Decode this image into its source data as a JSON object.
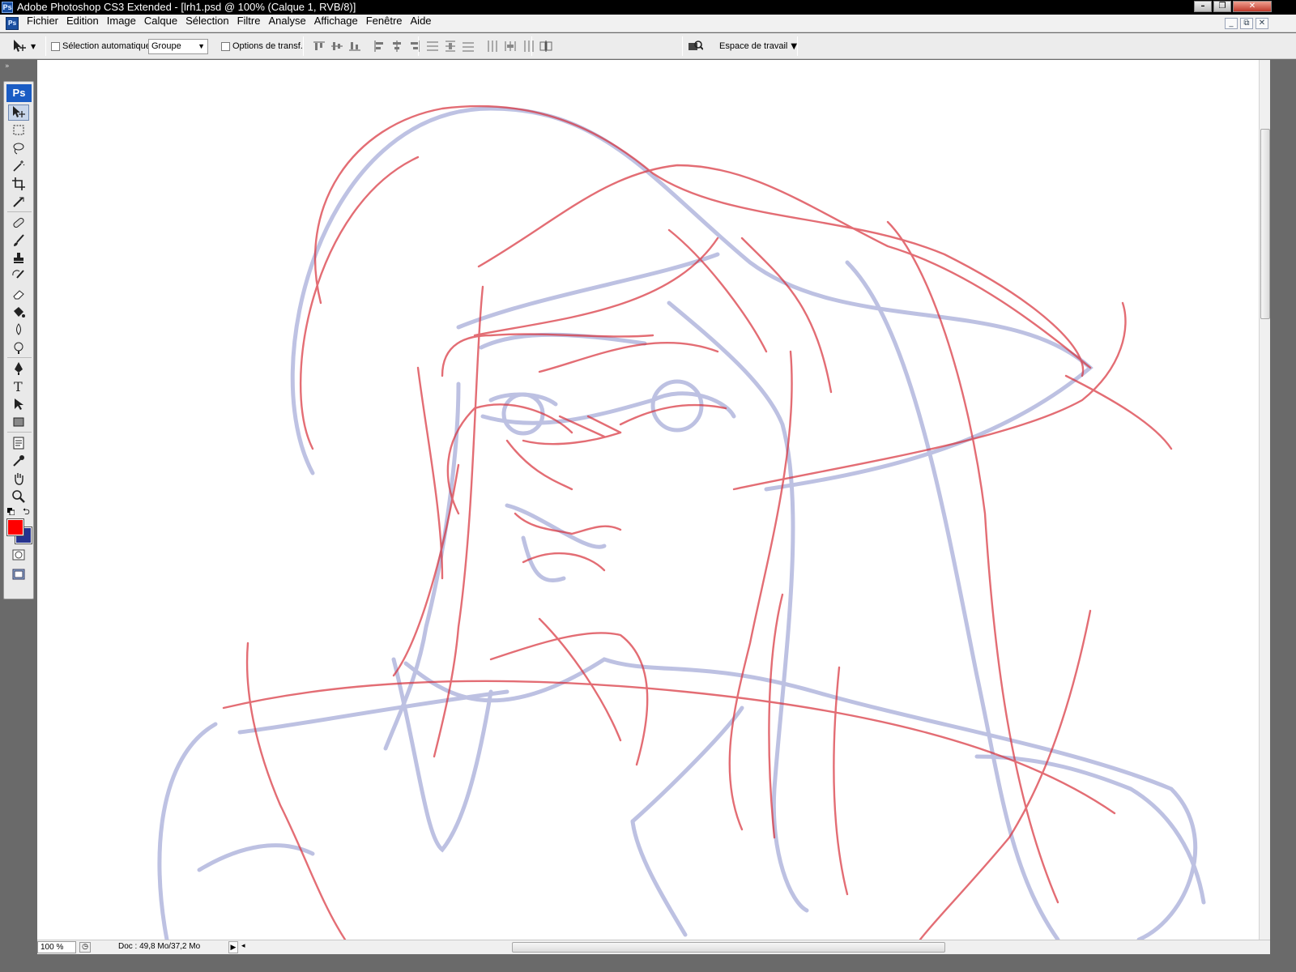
{
  "window": {
    "title": "Adobe Photoshop CS3 Extended - [lrh1.psd @ 100% (Calque 1, RVB/8)]",
    "app_logo": "Ps",
    "controls": [
      "minimize-icon",
      "restore-icon",
      "close-icon"
    ]
  },
  "menubar": {
    "items": [
      "Fichier",
      "Edition",
      "Image",
      "Calque",
      "Sélection",
      "Filtre",
      "Analyse",
      "Affichage",
      "Fenêtre",
      "Aide"
    ],
    "doc_controls": [
      "_",
      "⧉",
      "✕"
    ]
  },
  "options": {
    "auto_select_label": "Sélection automatique :",
    "auto_select_checked": false,
    "auto_select_value": "Groupe",
    "transform_label": "Options de transf.",
    "transform_checked": false,
    "workspace_label": "Espace de travail"
  },
  "toolbox": {
    "logo": "Ps",
    "foreground_color": "#ff0000",
    "background_color": "#26338f",
    "tools": [
      "move",
      "marquee",
      "lasso",
      "magic-wand",
      "crop",
      "slice",
      "healing",
      "brush",
      "stamp",
      "history-brush",
      "eraser",
      "paint-bucket",
      "blur",
      "dodge",
      "pen",
      "type",
      "path-select",
      "shape",
      "notes",
      "eyedropper",
      "hand",
      "zoom"
    ]
  },
  "status": {
    "zoom": "100 %",
    "doc_info": "Doc : 49,8 Mo/37,2 Mo"
  },
  "sketch_colors": {
    "red": "#d8303a",
    "blue": "#8890cc"
  }
}
